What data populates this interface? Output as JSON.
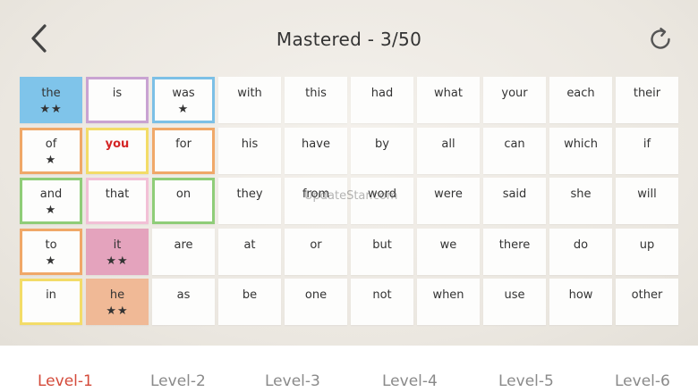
{
  "header": {
    "title": "Mastered - 3/50",
    "back_icon": "chevron-left-icon",
    "reset_icon": "refresh-icon"
  },
  "watermark": "UpdateStar.com",
  "cards": [
    {
      "word": "the",
      "stars": "★★",
      "style": "f-blue"
    },
    {
      "word": "is",
      "stars": "",
      "style": "b-purple"
    },
    {
      "word": "was",
      "stars": "★",
      "style": "b-blue"
    },
    {
      "word": "with",
      "stars": "",
      "style": ""
    },
    {
      "word": "this",
      "stars": "",
      "style": ""
    },
    {
      "word": "had",
      "stars": "",
      "style": ""
    },
    {
      "word": "what",
      "stars": "",
      "style": ""
    },
    {
      "word": "your",
      "stars": "",
      "style": ""
    },
    {
      "word": "each",
      "stars": "",
      "style": ""
    },
    {
      "word": "their",
      "stars": "",
      "style": ""
    },
    {
      "word": "of",
      "stars": "★",
      "style": "b-orange"
    },
    {
      "word": "you",
      "stars": "",
      "style": "b-yellow",
      "red": true
    },
    {
      "word": "for",
      "stars": "",
      "style": "b-orange"
    },
    {
      "word": "his",
      "stars": "",
      "style": ""
    },
    {
      "word": "have",
      "stars": "",
      "style": ""
    },
    {
      "word": "by",
      "stars": "",
      "style": ""
    },
    {
      "word": "all",
      "stars": "",
      "style": ""
    },
    {
      "word": "can",
      "stars": "",
      "style": ""
    },
    {
      "word": "which",
      "stars": "",
      "style": ""
    },
    {
      "word": "if",
      "stars": "",
      "style": ""
    },
    {
      "word": "and",
      "stars": "★",
      "style": "b-green"
    },
    {
      "word": "that",
      "stars": "",
      "style": "b-pink"
    },
    {
      "word": "on",
      "stars": "",
      "style": "b-green"
    },
    {
      "word": "they",
      "stars": "",
      "style": ""
    },
    {
      "word": "from",
      "stars": "",
      "style": ""
    },
    {
      "word": "word",
      "stars": "",
      "style": ""
    },
    {
      "word": "were",
      "stars": "",
      "style": ""
    },
    {
      "word": "said",
      "stars": "",
      "style": ""
    },
    {
      "word": "she",
      "stars": "",
      "style": ""
    },
    {
      "word": "will",
      "stars": "",
      "style": ""
    },
    {
      "word": "to",
      "stars": "★",
      "style": "b-orange"
    },
    {
      "word": "it",
      "stars": "★★",
      "style": "f-rose"
    },
    {
      "word": "are",
      "stars": "",
      "style": ""
    },
    {
      "word": "at",
      "stars": "",
      "style": ""
    },
    {
      "word": "or",
      "stars": "",
      "style": ""
    },
    {
      "word": "but",
      "stars": "",
      "style": ""
    },
    {
      "word": "we",
      "stars": "",
      "style": ""
    },
    {
      "word": "there",
      "stars": "",
      "style": ""
    },
    {
      "word": "do",
      "stars": "",
      "style": ""
    },
    {
      "word": "up",
      "stars": "",
      "style": ""
    },
    {
      "word": "in",
      "stars": "",
      "style": "b-yellow"
    },
    {
      "word": "he",
      "stars": "★★",
      "style": "f-peach"
    },
    {
      "word": "as",
      "stars": "",
      "style": ""
    },
    {
      "word": "be",
      "stars": "",
      "style": ""
    },
    {
      "word": "one",
      "stars": "",
      "style": ""
    },
    {
      "word": "not",
      "stars": "",
      "style": ""
    },
    {
      "word": "when",
      "stars": "",
      "style": ""
    },
    {
      "word": "use",
      "stars": "",
      "style": ""
    },
    {
      "word": "how",
      "stars": "",
      "style": ""
    },
    {
      "word": "other",
      "stars": "",
      "style": ""
    }
  ],
  "levels": [
    {
      "label": "Level-1",
      "active": true
    },
    {
      "label": "Level-2",
      "active": false
    },
    {
      "label": "Level-3",
      "active": false
    },
    {
      "label": "Level-4",
      "active": false
    },
    {
      "label": "Level-5",
      "active": false
    },
    {
      "label": "Level-6",
      "active": false
    }
  ]
}
